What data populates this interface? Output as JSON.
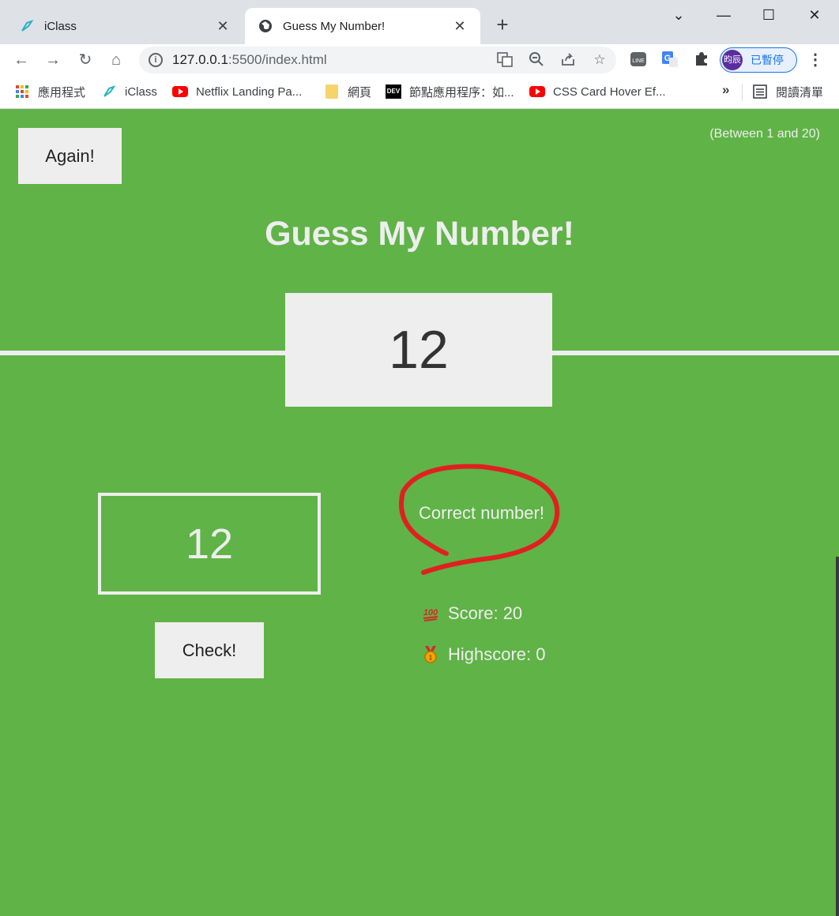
{
  "browser": {
    "tabs": [
      {
        "label": "iClass",
        "active": false,
        "icon": "iclass-logo-icon"
      },
      {
        "label": "Guess My Number!",
        "active": true,
        "icon": "globe-icon"
      }
    ],
    "address": {
      "host": "127.0.0.1",
      "path": ":5500/index.html"
    },
    "profile": {
      "avatar_text": "昀辰",
      "status_label": "已暫停"
    },
    "bookmarks": [
      {
        "label": "應用程式",
        "icon": "apps-grid-icon"
      },
      {
        "label": "iClass",
        "icon": "iclass-logo-icon"
      },
      {
        "label": "Netflix Landing Pa...",
        "icon": "youtube-icon"
      },
      {
        "label": "網頁",
        "icon": "folder-icon"
      },
      {
        "label": "節點應用程序：如...",
        "icon": "dev-icon"
      },
      {
        "label": "CSS Card Hover Ef...",
        "icon": "youtube-icon"
      }
    ],
    "bookmarks_more": "»",
    "reading_list_label": "閱讀清單"
  },
  "game": {
    "again_label": "Again!",
    "range_hint": "(Between 1 and 20)",
    "title": "Guess My Number!",
    "secret_number": "12",
    "guess_value": "12",
    "check_label": "Check!",
    "message": "Correct number!",
    "score_label": "Score: 20",
    "highscore_label": "Highscore: 0"
  },
  "colors": {
    "background_win": "#60b347",
    "light": "#eeeeee",
    "annotation": "#e02020"
  }
}
